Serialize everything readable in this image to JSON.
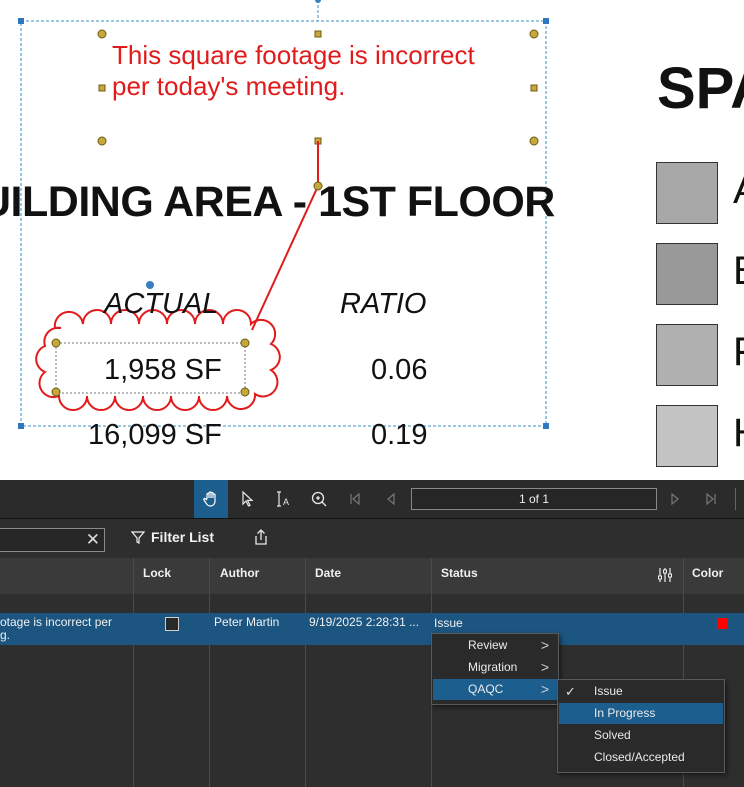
{
  "canvas": {
    "callout_text": "This square footage is incorrect\nper today's meeting.",
    "building_title": "UILDING AREA - 1ST FLOOR",
    "col_actual": "ACTUAL",
    "col_ratio": "RATIO",
    "rows": [
      {
        "actual": "1,958 SF",
        "ratio": "0.06"
      },
      {
        "actual": "16,099 SF",
        "ratio": "0.19"
      }
    ],
    "space_title": "SPA",
    "swatches": [
      {
        "label": "A",
        "color": "#a8a8a8"
      },
      {
        "label": "B",
        "color": "#999999"
      },
      {
        "label": "F",
        "color": "#b0b0b0"
      },
      {
        "label": "H",
        "color": "#c4c4c4"
      }
    ],
    "annotation_color": "#e11b1b"
  },
  "toolbar": {
    "page_indicator": "1 of 1",
    "icons": [
      "pan-hand-icon",
      "select-arrow-icon",
      "text-select-icon",
      "zoom-icon",
      "first-page-icon",
      "prev-page-icon",
      "next-page-icon",
      "last-page-icon"
    ]
  },
  "panel": {
    "search_value": "",
    "filter_label": "Filter List",
    "columns": [
      "Lock",
      "Author",
      "Date",
      "Status",
      "Color"
    ],
    "row": {
      "subject": "otage is incorrect per\ng.",
      "author": "Peter Martin",
      "date": "9/19/2025 2:28:31 ...",
      "status": "Issue",
      "color": "#ff0000"
    }
  },
  "status_menu": {
    "items": [
      "Review",
      "Migration",
      "QAQC"
    ],
    "highlighted": "QAQC"
  },
  "qaqc_submenu": {
    "items": [
      "Issue",
      "In Progress",
      "Solved",
      "Closed/Accepted"
    ],
    "checked": "Issue",
    "highlighted": "In Progress"
  }
}
